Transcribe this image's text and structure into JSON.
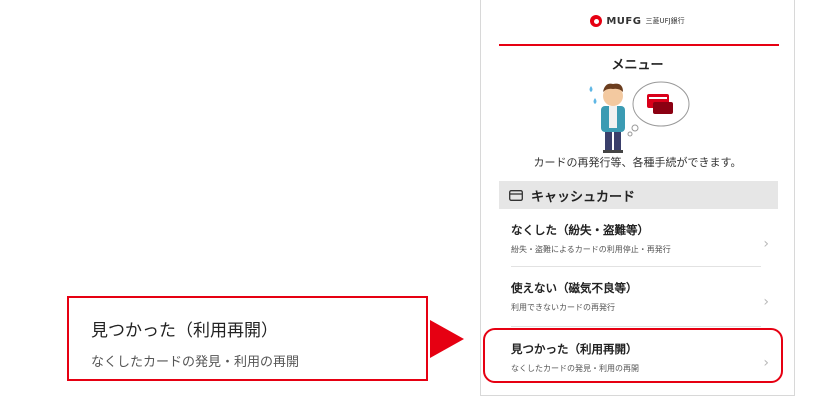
{
  "header": {
    "brand": "MUFG",
    "brand_sub": "三菱UFJ銀行"
  },
  "menu": {
    "title": "メニュー",
    "description": "カードの再発行等、各種手続ができます。"
  },
  "section": {
    "label": "キャッシュカード",
    "icon": "card-icon"
  },
  "items": [
    {
      "title": "なくした（紛失・盗難等）",
      "subtitle": "紛失・盗難によるカードの利用停止・再発行"
    },
    {
      "title": "使えない（磁気不良等）",
      "subtitle": "利用できないカードの再発行"
    },
    {
      "title": "見つかった（利用再開）",
      "subtitle": "なくしたカードの発見・利用の再開"
    }
  ],
  "callout": {
    "title": "見つかった（利用再開）",
    "subtitle": "なくしたカードの発見・利用の再開"
  },
  "colors": {
    "accent": "#e60012",
    "section_bg": "#e6e6e6"
  }
}
